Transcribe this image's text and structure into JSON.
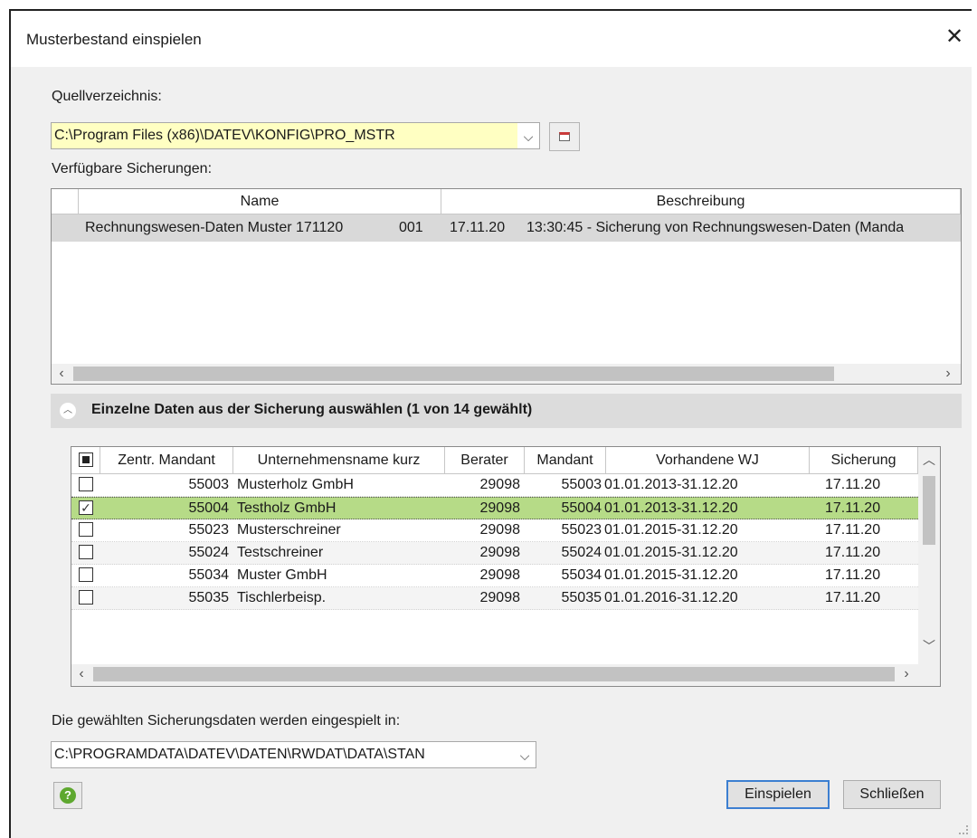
{
  "window": {
    "title": "Musterbestand einspielen",
    "close_label": "✕"
  },
  "source": {
    "label": "Quellverzeichnis:",
    "value": "C:\\Program Files (x86)\\DATEV\\KONFIG\\PRO_MSTR",
    "highlight_color": "#ffffc2"
  },
  "backups": {
    "label": "Verfügbare Sicherungen:",
    "columns": [
      "Name",
      "Beschreibung"
    ],
    "rows": [
      {
        "name": "Rechnungswesen-Daten Muster 171120",
        "num": "001",
        "date": "17.11.20",
        "desc": "13:30:45 - Sicherung von Rechnungswesen-Daten (Manda"
      }
    ]
  },
  "section": {
    "title": "Einzelne Daten aus der Sicherung auswählen (1 von 14 gewählt)"
  },
  "data_table": {
    "columns": [
      "Zentr. Mandant",
      "Unternehmensname kurz",
      "Berater",
      "Mandant",
      "Vorhandene WJ",
      "Sicherung"
    ],
    "rows": [
      {
        "checked": false,
        "zentr": "55003",
        "name": "Musterholz GmbH",
        "berater": "29098",
        "mandant": "55003",
        "wj": "01.01.2013-31.12.20",
        "sicherung": "17.11.20",
        "check_mark": ""
      },
      {
        "checked": true,
        "zentr": "55004",
        "name": "Testholz GmbH",
        "berater": "29098",
        "mandant": "55004",
        "wj": "01.01.2013-31.12.20",
        "sicherung": "17.11.20",
        "check_mark": "✓"
      },
      {
        "checked": false,
        "zentr": "55023",
        "name": "Musterschreiner",
        "berater": "29098",
        "mandant": "55023",
        "wj": "01.01.2015-31.12.20",
        "sicherung": "17.11.20",
        "check_mark": ""
      },
      {
        "checked": false,
        "zentr": "55024",
        "name": "Testschreiner",
        "berater": "29098",
        "mandant": "55024",
        "wj": "01.01.2015-31.12.20",
        "sicherung": "17.11.20",
        "check_mark": ""
      },
      {
        "checked": false,
        "zentr": "55034",
        "name": "Muster GmbH",
        "berater": "29098",
        "mandant": "55034",
        "wj": "01.01.2015-31.12.20",
        "sicherung": "17.11.20",
        "check_mark": ""
      },
      {
        "checked": false,
        "zentr": "55035",
        "name": "Tischlerbeisp.",
        "berater": "29098",
        "mandant": "55035",
        "wj": "01.01.2016-31.12.20",
        "sicherung": "17.11.20",
        "check_mark": ""
      }
    ],
    "selected_row_color": "#b6db87"
  },
  "target": {
    "label": "Die gewählten Sicherungsdaten werden eingespielt in:",
    "value": "C:\\PROGRAMDATA\\DATEV\\DATEN\\RWDAT\\DATA\\STAN"
  },
  "buttons": {
    "import": "Einspielen",
    "close": "Schließen",
    "help_glyph": "?"
  },
  "icons": {
    "dropdown": "chevron-down-icon",
    "browse": "folder-browse-icon",
    "help": "help-icon",
    "collapse": "chevron-up-icon"
  }
}
